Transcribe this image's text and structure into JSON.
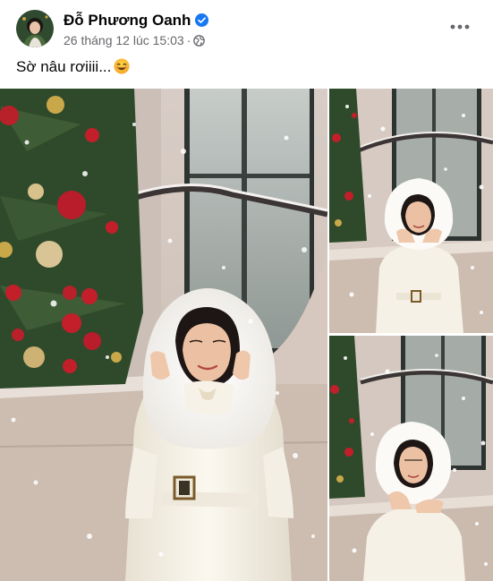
{
  "post": {
    "author_name": "Đỗ Phương Oanh",
    "timestamp": "26 tháng 12 lúc 15:03",
    "separator": "·",
    "caption": "Sờ nâu rơiiii...",
    "icons": {
      "verified": "verified-badge-icon",
      "audience": "globe-icon",
      "more": "more-options-icon",
      "emoji": "smiling-emoji-icon"
    },
    "colors": {
      "verified": "#1877f2",
      "secondary_text": "#65676b",
      "primary_text": "#050505"
    },
    "photos": [
      {
        "name": "woman-in-white-hooded-coat-christmas-tree"
      },
      {
        "name": "woman-catching-snow-top"
      },
      {
        "name": "woman-catching-snow-bottom"
      }
    ]
  }
}
